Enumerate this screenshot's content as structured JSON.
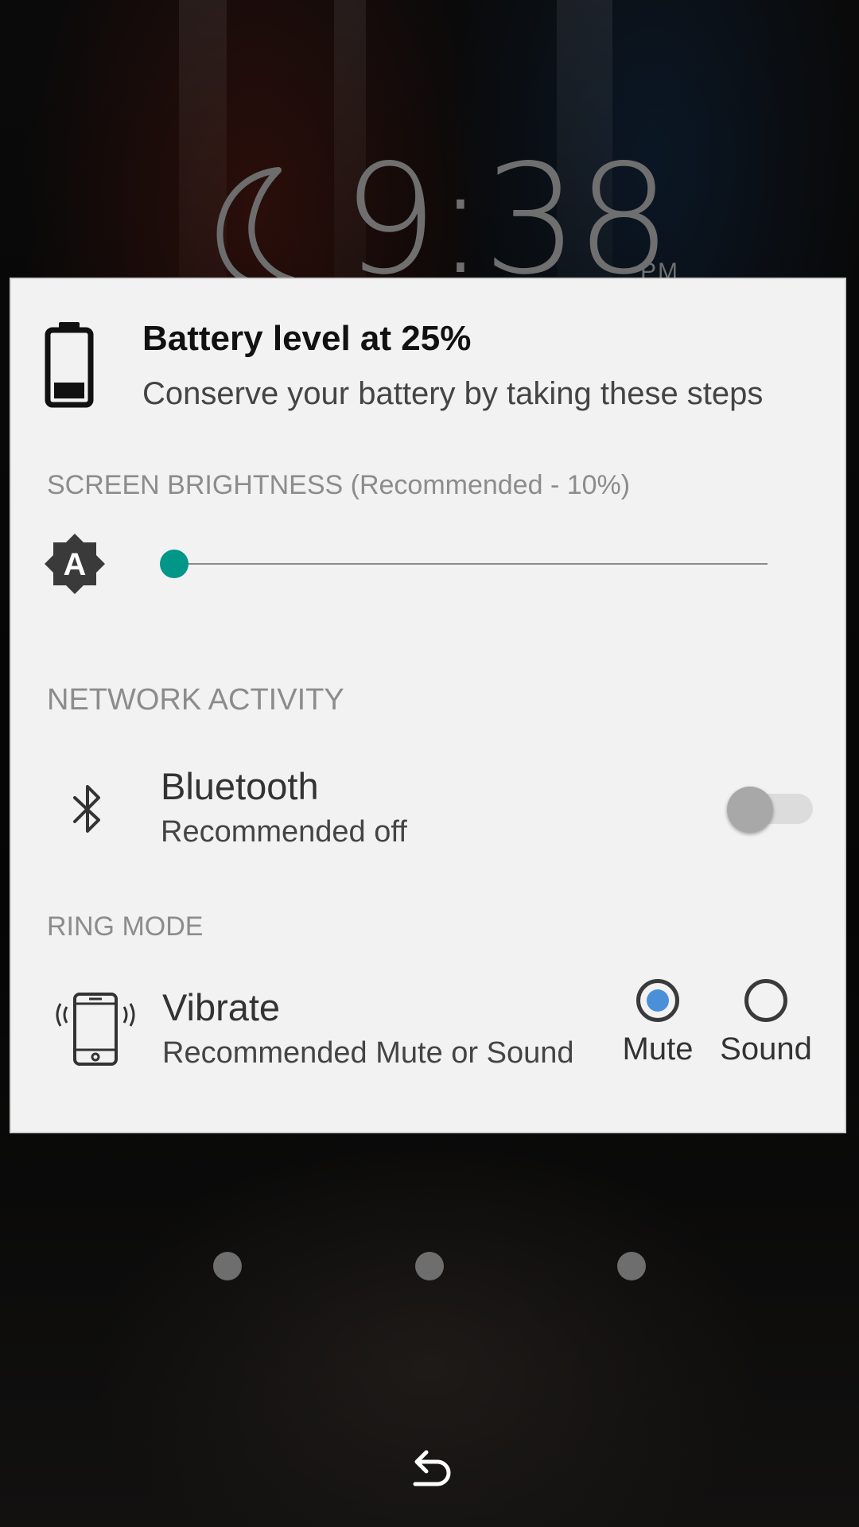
{
  "clock": {
    "time": "9:38",
    "ampm": "PM"
  },
  "dialog": {
    "title": "Battery level at 25%",
    "subtitle": "Conserve your battery by taking these steps",
    "icon": "battery-low-icon",
    "brightness": {
      "header": "SCREEN BRIGHTNESS (Recommended - 10%)",
      "icon": "auto-brightness-icon",
      "level_fraction": 0.0
    },
    "network": {
      "header": "NETWORK ACTIVITY",
      "bluetooth": {
        "icon": "bluetooth-icon",
        "title": "Bluetooth",
        "subtitle": "Recommended off",
        "enabled": false
      }
    },
    "ring_mode": {
      "header": "RING MODE",
      "icon": "phone-vibrate-icon",
      "title": "Vibrate",
      "subtitle": "Recommended Mute or Sound",
      "options": [
        {
          "label": "Mute",
          "selected": true
        },
        {
          "label": "Sound",
          "selected": false
        }
      ]
    }
  },
  "pager": {
    "dots": 3
  },
  "navigation": {
    "back_icon": "back-arrow-icon"
  },
  "colors": {
    "accent": "#009688",
    "radio_selected": "#4a90d9",
    "card_bg": "#f2f2f2"
  }
}
